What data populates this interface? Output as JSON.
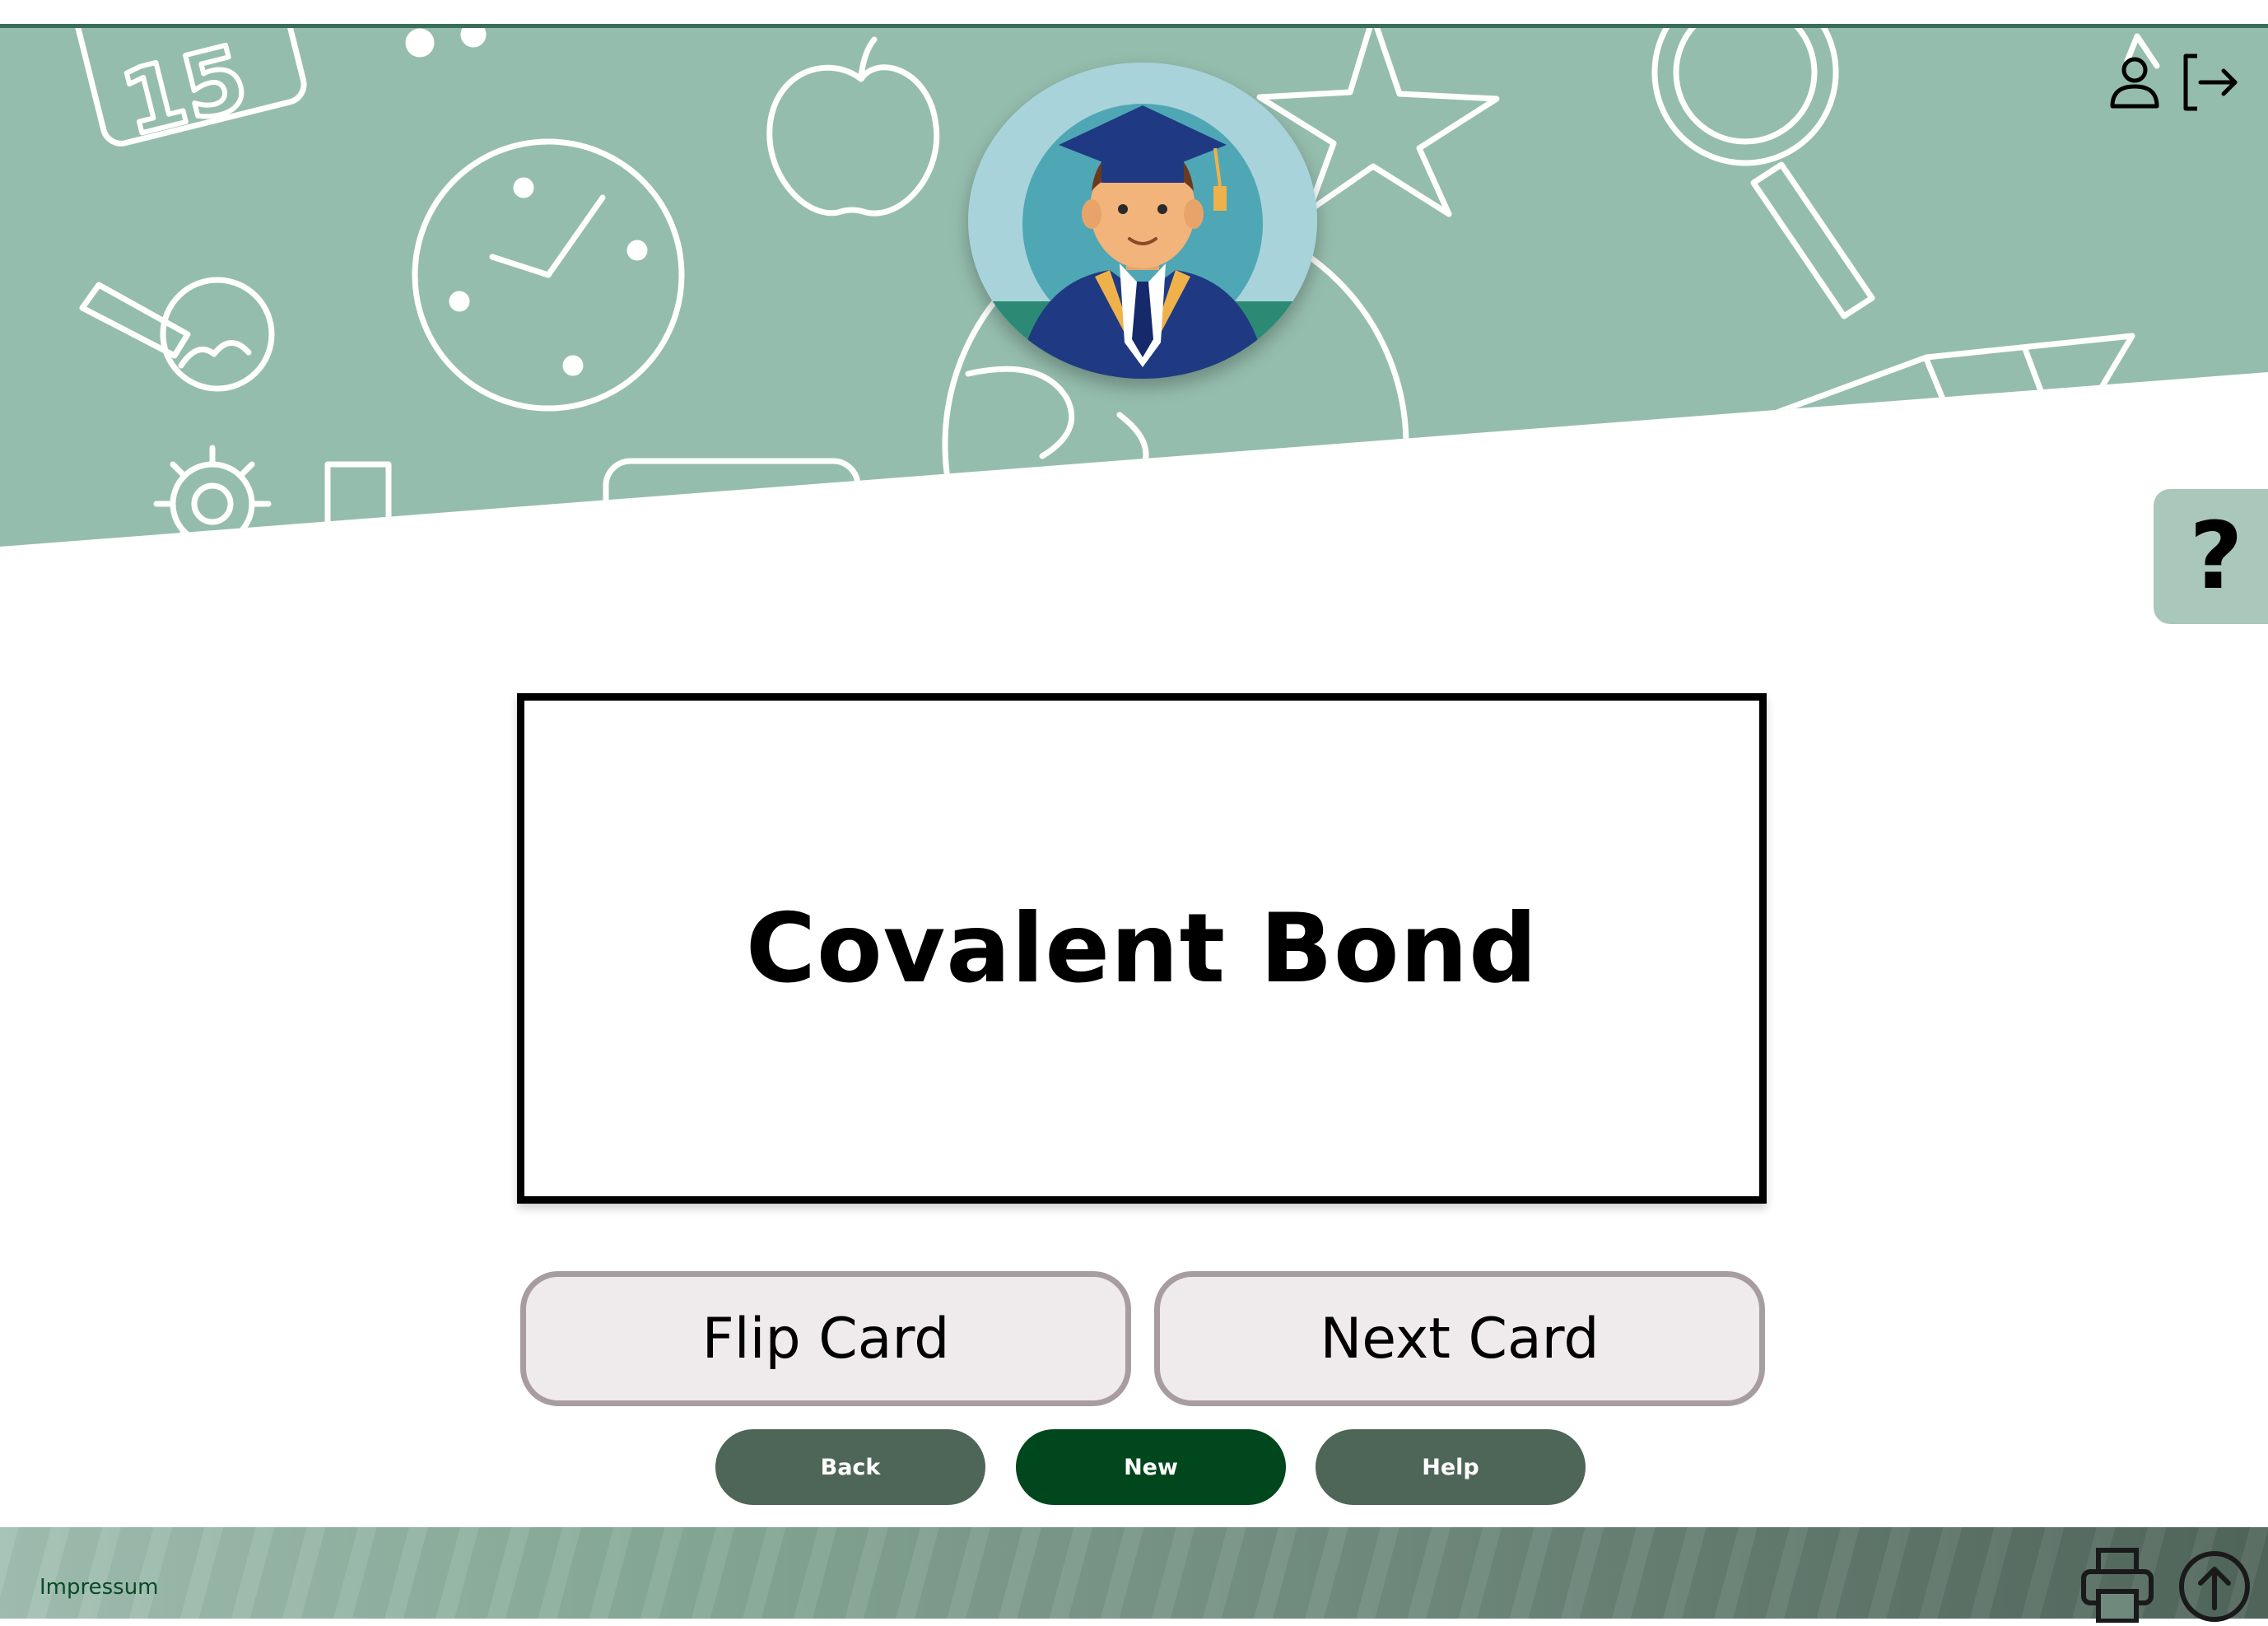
{
  "card": {
    "text": "Covalent Bond"
  },
  "actions": {
    "flip_label": "Flip Card",
    "next_label": "Next Card"
  },
  "nav": {
    "back_label": "Back",
    "new_label": "New",
    "help_label": "Help"
  },
  "help_tab": {
    "symbol": "?"
  },
  "header": {
    "icons": [
      "user-icon",
      "logout-icon"
    ],
    "banner_color": "#95bdad",
    "doodle_text": "15"
  },
  "footer": {
    "impressum_label": "Impressum",
    "icons": [
      "printer-icon",
      "arrow-up-circle-icon"
    ]
  },
  "colors": {
    "accent_dark": "#00471d",
    "accent_muted": "#4e6657",
    "help_tab": "#a9c7ba"
  }
}
